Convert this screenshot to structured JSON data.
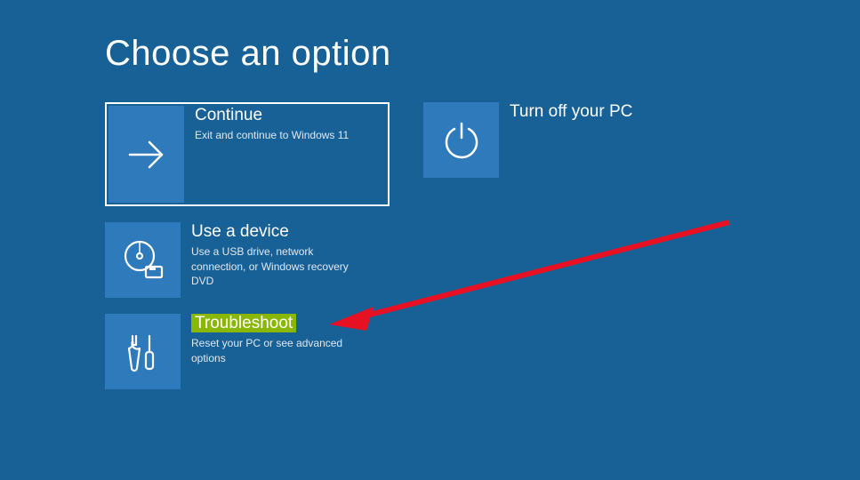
{
  "page_title": "Choose an option",
  "tiles": {
    "continue": {
      "title": "Continue",
      "desc": "Exit and continue to Windows 11"
    },
    "turnoff": {
      "title": "Turn off your PC",
      "desc": ""
    },
    "usedevice": {
      "title": "Use a device",
      "desc": "Use a USB drive, network connection, or Windows recovery DVD"
    },
    "troubleshoot": {
      "title": "Troubleshoot",
      "desc": "Reset your PC or see advanced options"
    }
  },
  "annotation": {
    "type": "arrow",
    "target": "troubleshoot",
    "color": "#e81123"
  }
}
